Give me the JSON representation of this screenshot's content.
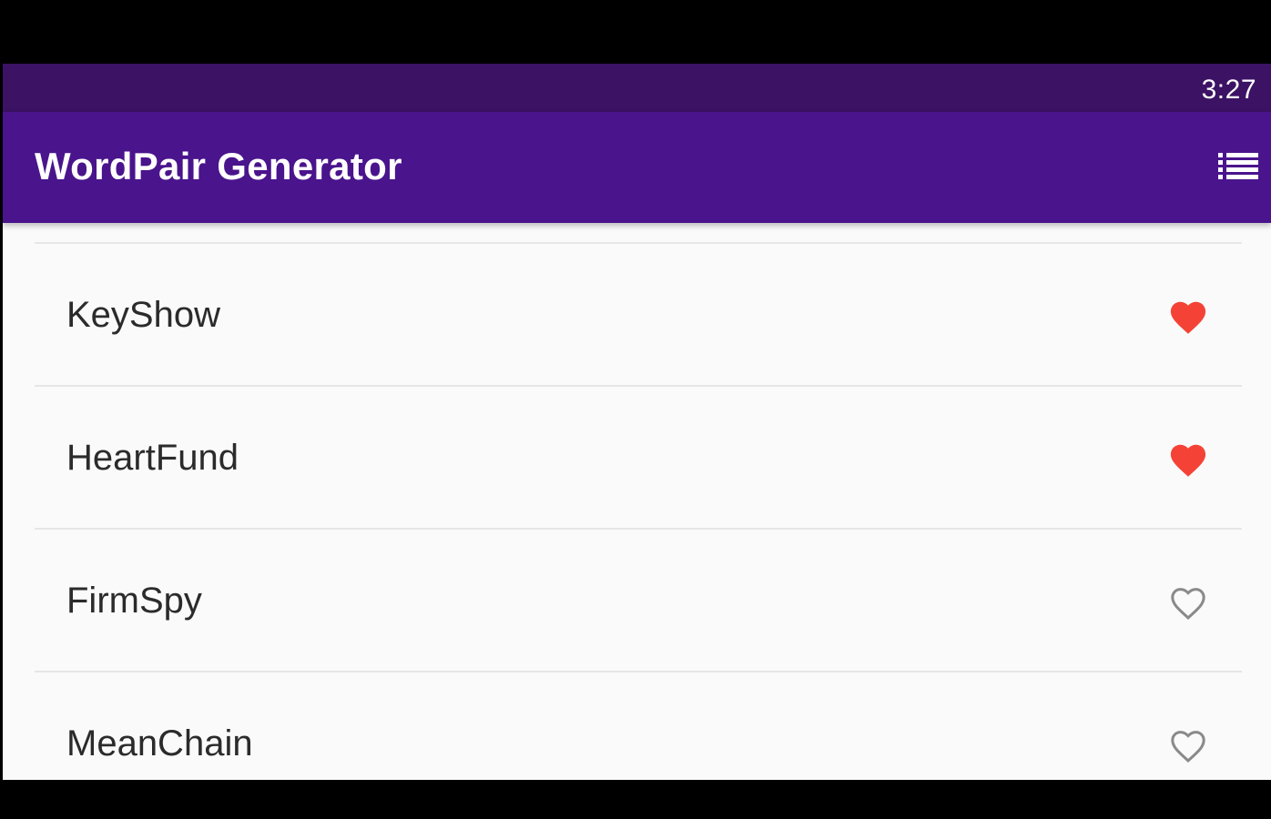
{
  "status_bar": {
    "time": "3:27"
  },
  "app_bar": {
    "title": "WordPair Generator",
    "action_icon": "list-icon"
  },
  "colors": {
    "status_bar": "#3b1264",
    "app_bar": "#4a148c",
    "heart_saved": "#f44336",
    "heart_unsaved": "#8a8a8a"
  },
  "list": {
    "items": [
      {
        "label": "KeyShow",
        "saved": true
      },
      {
        "label": "HeartFund",
        "saved": true
      },
      {
        "label": "FirmSpy",
        "saved": false
      },
      {
        "label": "MeanChain",
        "saved": false
      }
    ]
  }
}
